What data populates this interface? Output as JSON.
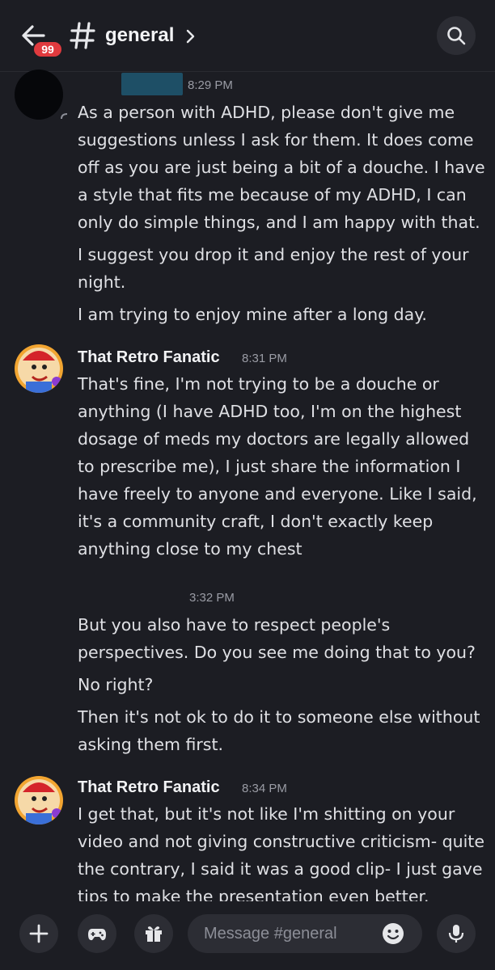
{
  "header": {
    "unread_badge": "99",
    "channel_name": "general"
  },
  "messages": [
    {
      "author": "",
      "time": "8:29 PM",
      "paragraphs": [
        "As a person with ADHD, please don't give me suggestions unless I ask for them. It does come off as you are just being a bit of a douche. I have a style that fits me because of my ADHD, I can only do simple things, and I am happy with that.",
        "I suggest you drop it and enjoy the rest of your night.",
        "I am trying to enjoy mine after a long day."
      ]
    },
    {
      "author": "That Retro Fanatic",
      "time": "8:31 PM",
      "paragraphs": [
        "That's fine, I'm not trying to be a douche or anything (I have ADHD too, I'm on the highest dosage of meds my doctors are legally allowed to prescribe me), I just share the information I have freely to anyone and everyone. Like I said, it's a community craft, I don't exactly keep anything close to my chest"
      ]
    },
    {
      "author": "",
      "time": "3:32 PM",
      "paragraphs": [
        "But you also have to respect people's perspectives. Do you see me doing that to you?",
        "No right?",
        "Then it's not ok to do it to someone else without asking them first."
      ]
    },
    {
      "author": "That Retro Fanatic",
      "time": "8:34 PM",
      "paragraphs": [
        "I get that, but it's not like I'm shitting on your video and not giving constructive criticism- quite the contrary, I said it was a good clip- I just gave tips to make the presentation even better."
      ]
    }
  ],
  "composer": {
    "placeholder": "Message #general"
  },
  "colors": {
    "background": "#1c1d23",
    "button_bg": "#2c2d34",
    "badge": "#e03a3e",
    "text": "#dfe0e4",
    "timestamp": "#9a9ca5"
  }
}
